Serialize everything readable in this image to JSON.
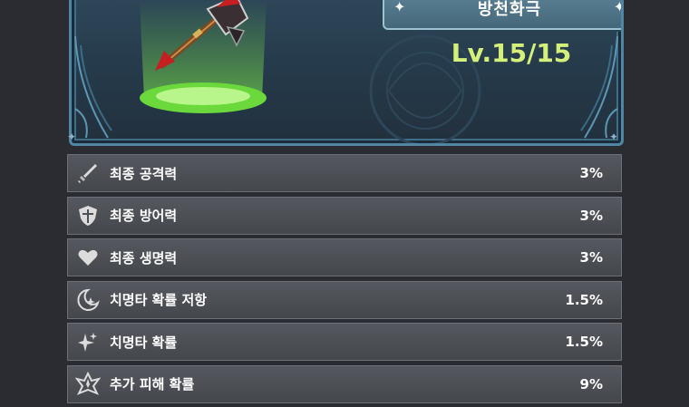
{
  "item": {
    "name": "방천화극",
    "level": "Lv.15/15",
    "icon": "halberd-weapon-icon",
    "pedestal_color": "#7de84e"
  },
  "stats": [
    {
      "label": "최종 공격력",
      "value": "3%",
      "icon": "sword-icon"
    },
    {
      "label": "최종 방어력",
      "value": "3%",
      "icon": "shield-icon"
    },
    {
      "label": "최종 생명력",
      "value": "3%",
      "icon": "heart-icon"
    },
    {
      "label": "치명타 확률 저항",
      "value": "1.5%",
      "icon": "crit-resist-icon"
    },
    {
      "label": "치명타 확률",
      "value": "1.5%",
      "icon": "crit-sparkle-icon"
    },
    {
      "label": "추가 피해 확률",
      "value": "9%",
      "icon": "extra-damage-icon"
    }
  ],
  "colors": {
    "level_text": "#d2f07a",
    "panel_border": "#4f86a3",
    "row_bg": "#4d5055"
  }
}
